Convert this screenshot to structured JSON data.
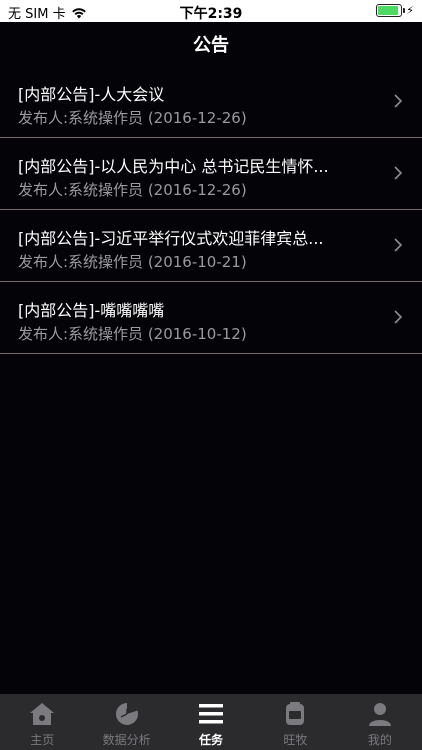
{
  "status_bar": {
    "carrier": "无 SIM 卡",
    "time": "下午2:39",
    "charging_symbol": "⚡"
  },
  "nav": {
    "title": "公告"
  },
  "announcements": [
    {
      "title": "[内部公告]-人大会议",
      "subtitle": "发布人:系统操作员 (2016-12-26)"
    },
    {
      "title": "[内部公告]-以人民为中心 总书记民生情怀...",
      "subtitle": "发布人:系统操作员 (2016-12-26)"
    },
    {
      "title": "[内部公告]-习近平举行仪式欢迎菲律宾总...",
      "subtitle": "发布人:系统操作员 (2016-10-21)"
    },
    {
      "title": "[内部公告]-嘴嘴嘴嘴",
      "subtitle": "发布人:系统操作员 (2016-10-12)"
    }
  ],
  "tabs": [
    {
      "label": "主页",
      "icon": "home-icon"
    },
    {
      "label": "数据分析",
      "icon": "pie-chart-icon"
    },
    {
      "label": "任务",
      "icon": "list-icon",
      "active": true
    },
    {
      "label": "旺牧",
      "icon": "jar-icon"
    },
    {
      "label": "我的",
      "icon": "person-icon"
    }
  ],
  "colors": {
    "background": "#030308",
    "divider": "#7a6a6c",
    "tab_bar": "#2b2b2e",
    "tab_inactive": "#7a7a7f",
    "battery": "#4cd964"
  }
}
